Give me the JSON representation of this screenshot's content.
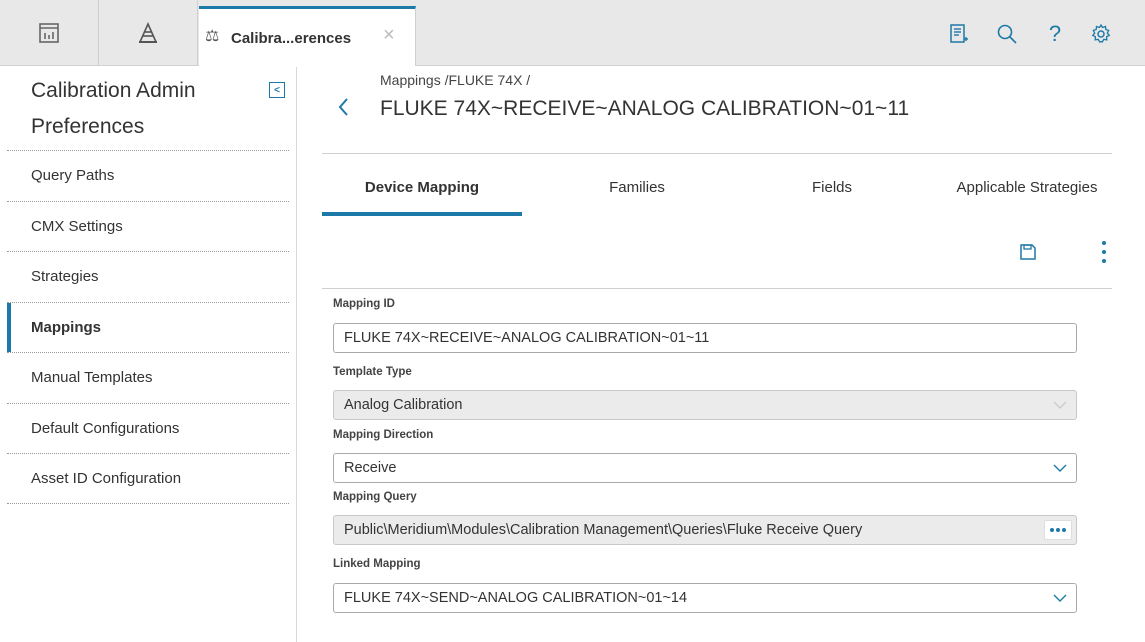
{
  "topbar": {
    "tab_title": "Calibra...erences",
    "icons": [
      "dashboard-icon",
      "asset-hierarchy-icon",
      "calibration-scale-icon",
      "notes-icon",
      "search-icon",
      "help-icon",
      "settings-icon"
    ],
    "help_glyph": "?"
  },
  "sidebar": {
    "title": "Calibration Admin Preferences",
    "collapse_glyph": "<",
    "items": [
      {
        "label": "Query Paths"
      },
      {
        "label": "CMX Settings"
      },
      {
        "label": "Strategies"
      },
      {
        "label": "Mappings"
      },
      {
        "label": "Manual Templates"
      },
      {
        "label": "Default Configurations"
      },
      {
        "label": "Asset ID Configuration"
      }
    ],
    "active_item": "Mappings"
  },
  "main": {
    "breadcrumb": "Mappings /FLUKE 74X /",
    "title": "FLUKE 74X~RECEIVE~ANALOG CALIBRATION~01~11",
    "tabs": [
      {
        "label": "Device Mapping"
      },
      {
        "label": "Families"
      },
      {
        "label": "Fields"
      },
      {
        "label": "Applicable Strategies"
      }
    ],
    "active_tab": "Device Mapping",
    "fields": {
      "mapping_id": {
        "label": "Mapping ID",
        "value": "FLUKE 74X~RECEIVE~ANALOG CALIBRATION~01~11"
      },
      "template_type": {
        "label": "Template Type",
        "value": "Analog Calibration"
      },
      "mapping_direction": {
        "label": "Mapping Direction",
        "value": "Receive"
      },
      "mapping_query": {
        "label": "Mapping Query",
        "value": "Public\\Meridium\\Modules\\Calibration Management\\Queries\\Fluke Receive Query"
      },
      "linked_mapping": {
        "label": "Linked Mapping",
        "value": "FLUKE 74X~SEND~ANALOG CALIBRATION~01~14"
      }
    }
  },
  "colors": {
    "accent": "#1d79a7",
    "topbar_bg": "#e8e8e8",
    "disabled_field_bg": "#ebebeb"
  }
}
